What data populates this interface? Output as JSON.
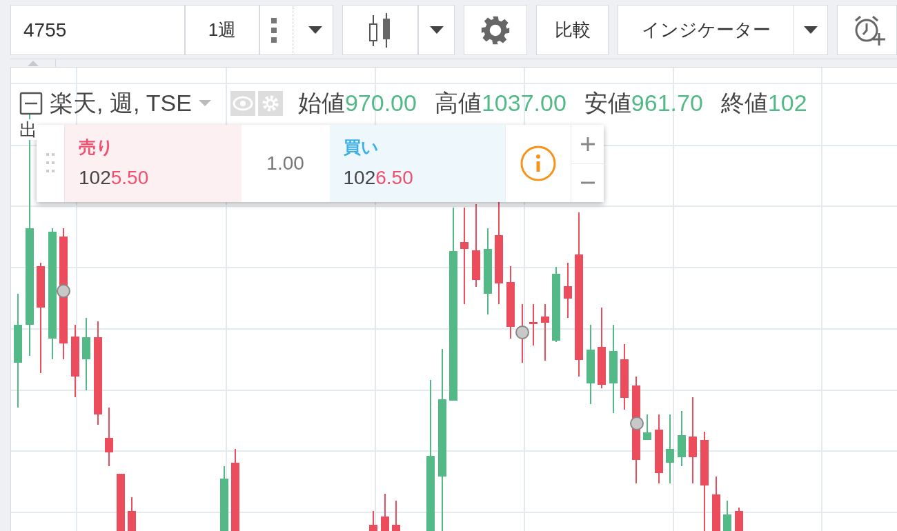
{
  "toolbar": {
    "symbol": "4755",
    "interval": "1週",
    "compare": "比較",
    "indicators": "インジケーター"
  },
  "legend": {
    "title": "楽天, 週, TSE",
    "values": [
      {
        "label": "始値",
        "value": "970.00"
      },
      {
        "label": "高値",
        "value": "1037.00"
      },
      {
        "label": "安値",
        "value": "961.70"
      },
      {
        "label": "終値",
        "value": "102"
      }
    ],
    "second_row": "出"
  },
  "trade_panel": {
    "sell": {
      "label": "売り",
      "price_main": "102",
      "price_highlight": "5.50"
    },
    "quantity": "1.00",
    "buy": {
      "label": "買い",
      "price_main": "102",
      "price_highlight": "6.50"
    }
  }
}
